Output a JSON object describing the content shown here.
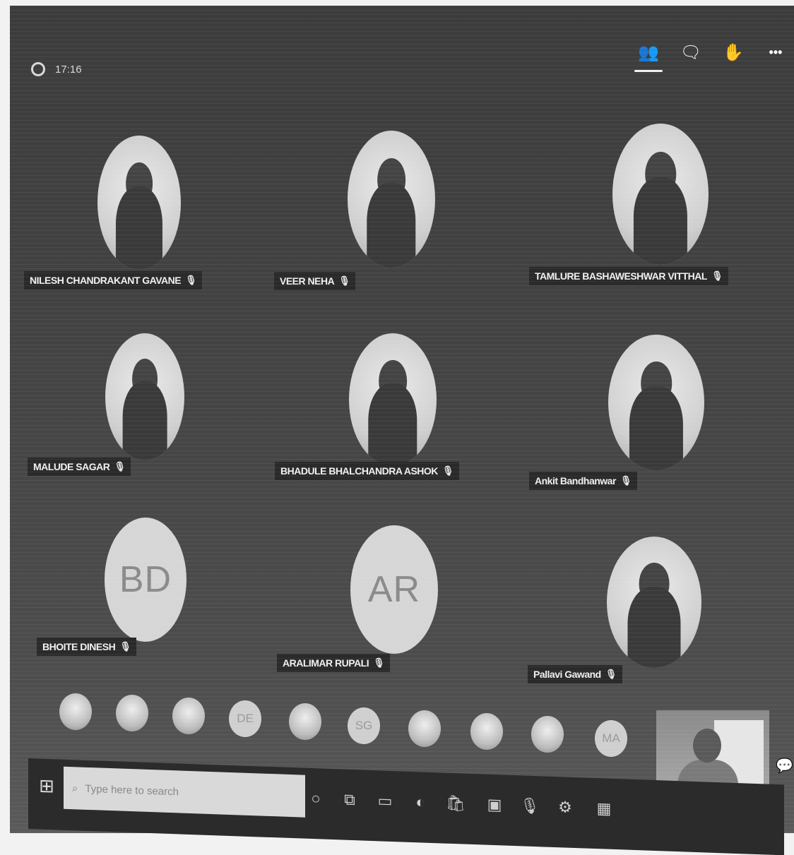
{
  "meeting": {
    "elapsed_time": "17:16"
  },
  "top_actions": [
    {
      "name": "participants-icon",
      "glyph": "👥",
      "active": true
    },
    {
      "name": "chat-icon",
      "glyph": "🗨"
    },
    {
      "name": "raise-hand-icon",
      "glyph": "✋"
    },
    {
      "name": "more-options-icon",
      "glyph": "•••"
    }
  ],
  "participants": [
    {
      "name": "NILESH CHANDRAKANT GAVANE",
      "avatar": "photo"
    },
    {
      "name": "VEER NEHA",
      "avatar": "photo"
    },
    {
      "name": "TAMLURE BASHAWESHWAR VITTHAL",
      "avatar": "photo"
    },
    {
      "name": "MALUDE SAGAR",
      "avatar": "photo"
    },
    {
      "name": "BHADULE BHALCHANDRA ASHOK",
      "avatar": "photo"
    },
    {
      "name": "Ankit Bandhanwar",
      "avatar": "photo"
    },
    {
      "name": "BHOITE DINESH",
      "avatar": "initials",
      "initials": "BD"
    },
    {
      "name": "ARALIMAR RUPALI",
      "avatar": "initials",
      "initials": "AR"
    },
    {
      "name": "Pallavi Gawand",
      "avatar": "photo"
    }
  ],
  "mic_glyph": "🎙",
  "overflow_strip": [
    {
      "type": "photo"
    },
    {
      "type": "photo"
    },
    {
      "type": "photo"
    },
    {
      "type": "initials",
      "initials": "DE"
    },
    {
      "type": "photo"
    },
    {
      "type": "initials",
      "initials": "SG"
    },
    {
      "type": "photo"
    },
    {
      "type": "photo"
    },
    {
      "type": "photo"
    },
    {
      "type": "initials",
      "initials": "MA"
    }
  ],
  "taskbar": {
    "start_glyph": "⊞",
    "search_placeholder": "Type here to search",
    "search_glyph": "⌕",
    "icons": [
      "○",
      "⧉",
      "▭",
      "◐",
      "🛍",
      "▣",
      "🎙",
      "⚙",
      "▦"
    ]
  },
  "chat_button_glyph": "💬"
}
